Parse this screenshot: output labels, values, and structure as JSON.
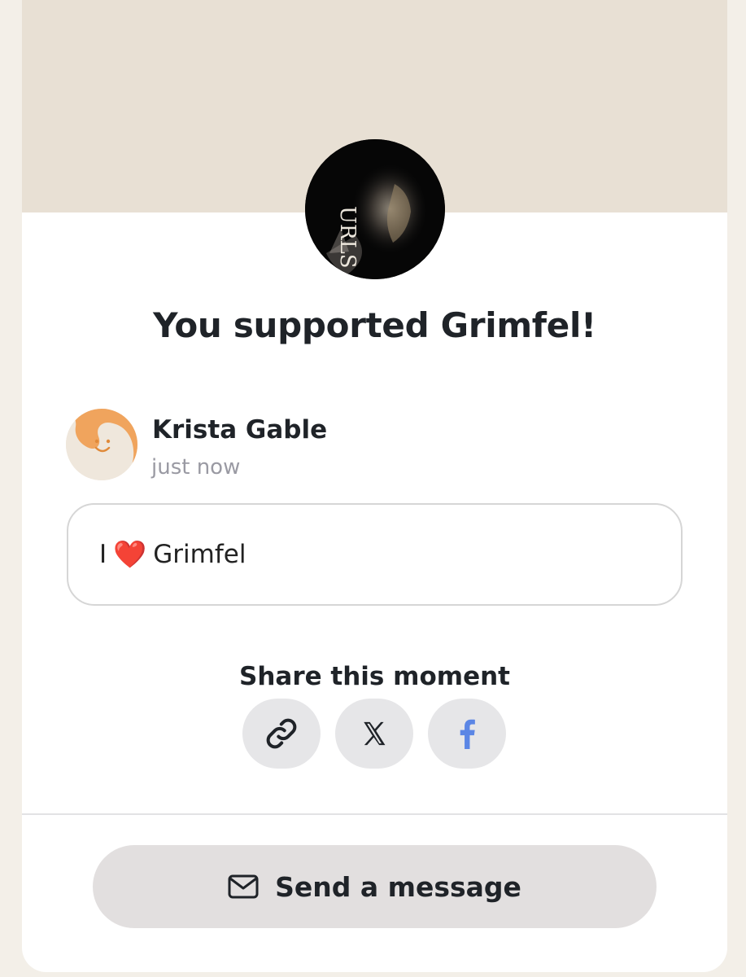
{
  "creator": {
    "avatar_alt": "Grimfel avatar",
    "avatar_text": "URLS"
  },
  "confirmation": {
    "title": "You supported Grimfel!"
  },
  "supporter": {
    "name": "Krista Gable",
    "time": "just now"
  },
  "message": {
    "prefix": "I",
    "heart": "❤️",
    "suffix": "Grimfel"
  },
  "share": {
    "title": "Share this moment",
    "buttons": [
      {
        "icon": "link-icon"
      },
      {
        "icon": "x-icon"
      },
      {
        "icon": "facebook-icon"
      }
    ]
  },
  "send_message": {
    "label": "Send a message",
    "icon": "envelope-icon"
  },
  "colors": {
    "cover": "#e8e0d4",
    "accent_orange": "#f0a45d",
    "facebook_blue": "#5b86e5"
  }
}
